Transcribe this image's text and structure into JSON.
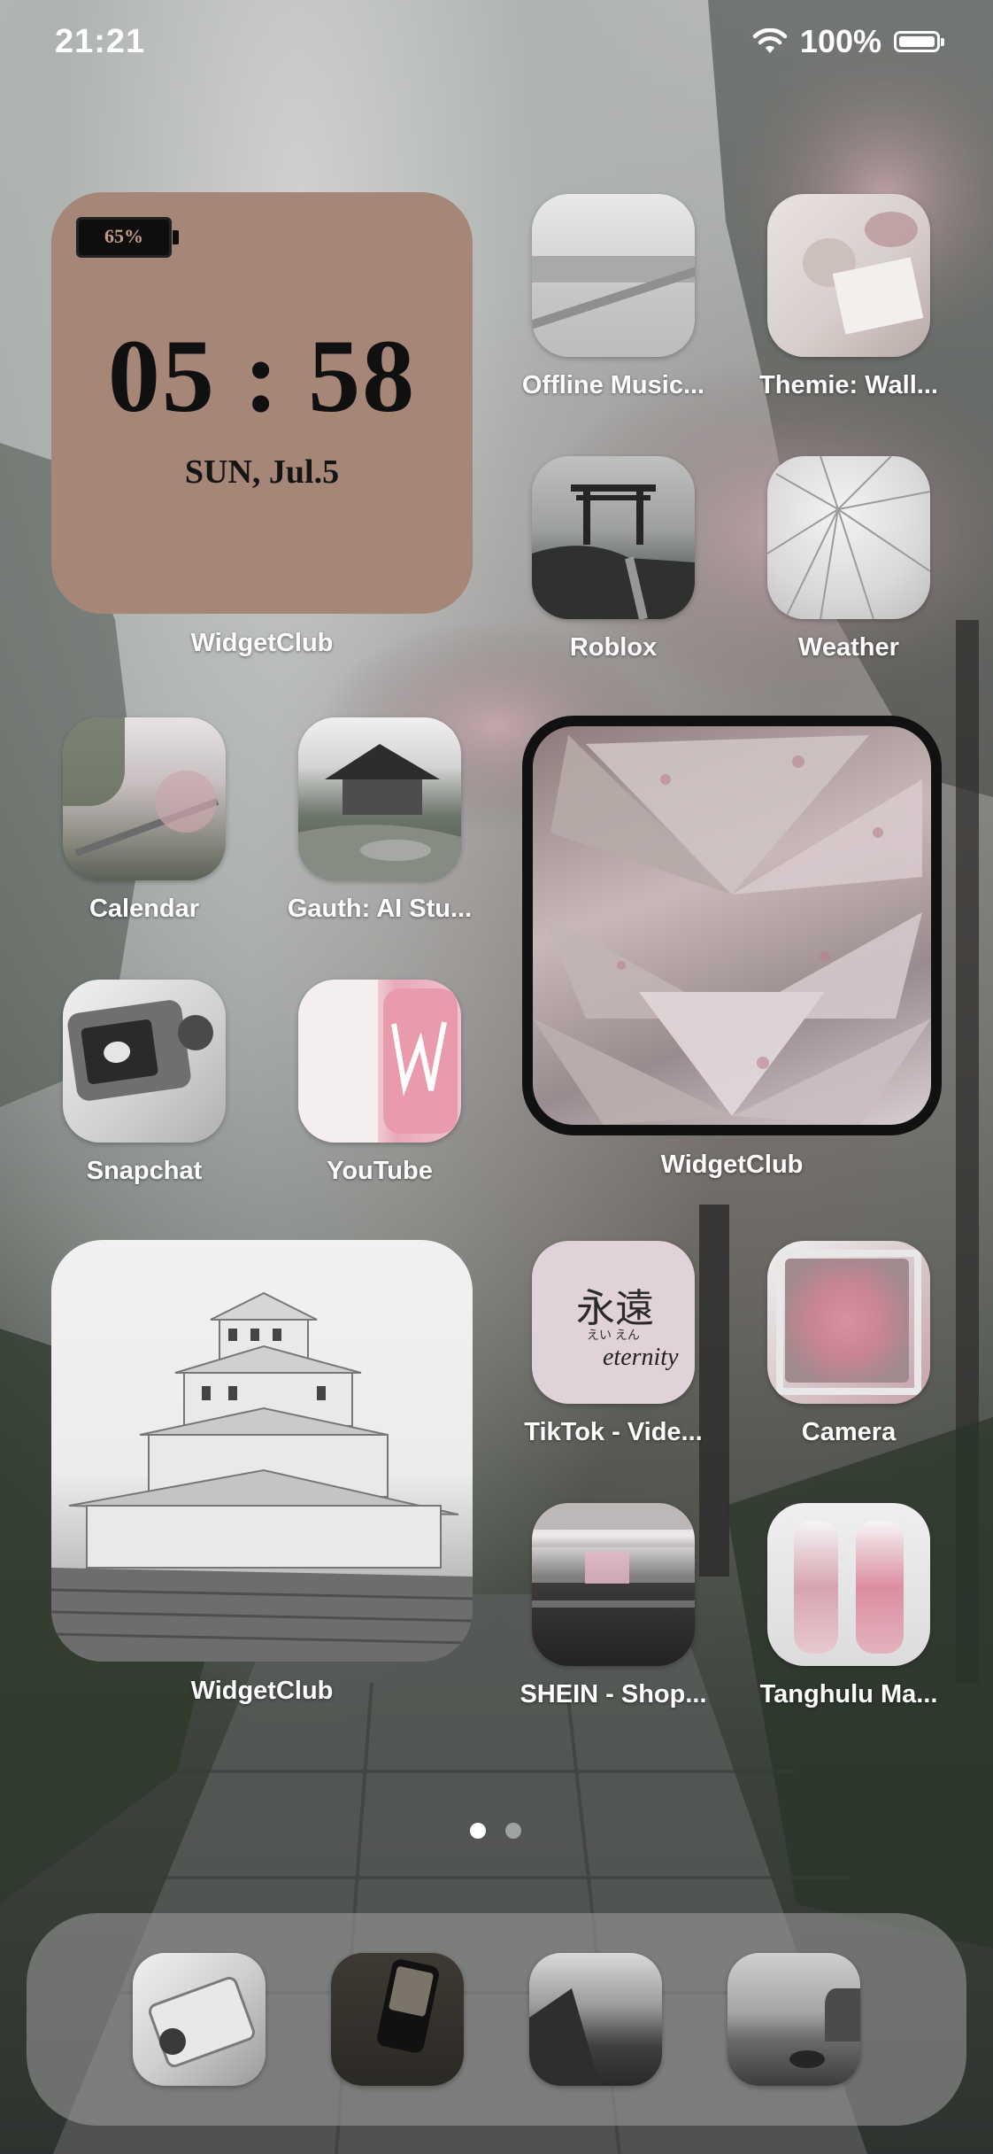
{
  "status_bar": {
    "time": "21:21",
    "battery_percent": "100%",
    "wifi_icon": "wifi-icon",
    "battery_icon": "battery-icon"
  },
  "clock_widget": {
    "battery": "65%",
    "time": "05 : 58",
    "date": "SUN, Jul.5",
    "label": "WidgetClub",
    "bg_color": "#a58677"
  },
  "apps": {
    "offline_music": "Offline Music...",
    "themie": "Themie: Wall...",
    "roblox": "Roblox",
    "weather": "Weather",
    "calendar": "Calendar",
    "gauth": "Gauth: AI Stu...",
    "snapchat": "Snapchat",
    "youtube": "YouTube",
    "tiktok": "TikTok - Vide...",
    "camera": "Camera",
    "shein": "SHEIN - Shop...",
    "tanghulu": "Tanghulu Ma..."
  },
  "widgets": {
    "fans_label": "WidgetClub",
    "castle_label": "WidgetClub"
  },
  "tiktok_icon_text": {
    "kanji": "永遠",
    "kana": "えい えん",
    "word": "eternity"
  },
  "page_indicator": {
    "pages": 2,
    "current": 1
  },
  "dock": {
    "icons": [
      "dock-app-1-icon",
      "dock-app-2-icon",
      "dock-app-3-icon",
      "dock-app-4-icon"
    ]
  }
}
